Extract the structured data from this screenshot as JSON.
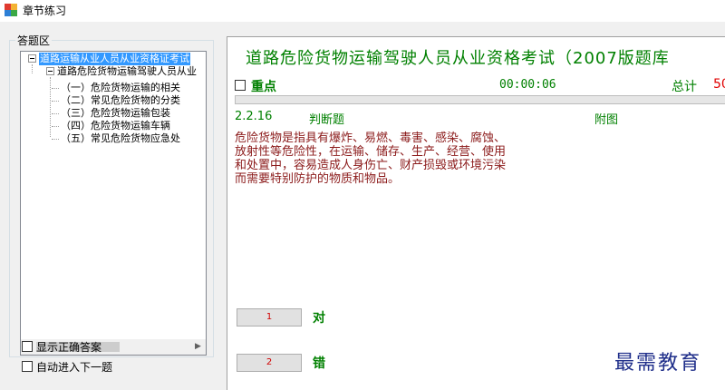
{
  "window": {
    "title": "章节练习"
  },
  "answer_area": {
    "group_title": "答题区",
    "tree": {
      "root": "道路运输从业人员从业资格证考试",
      "child": "道路危险货物运输驾驶人员从业",
      "leaves": [
        "（一）危险货物运输的相关",
        "（二）常见危险货物的分类",
        "（三）危险货物运输包装",
        "（四）危险货物运输车辆",
        "（五）常见危险货物应急处"
      ]
    },
    "options": {
      "show_answer": "显示正确答案",
      "auto_next": "自动进入下一题"
    }
  },
  "exam": {
    "title": "道路危险货物运输驾驶人员从业资格考试（2007版题库",
    "keypoint_label": "重点",
    "timer": "00:00:06",
    "total_label": "总计",
    "total_value": "50",
    "progress_fraction": 0.0
  },
  "question": {
    "number": "2.2.16",
    "type": "判断题",
    "figure_label": "附图",
    "text_lines": [
      "危险货物是指具有爆炸、易燃、毒害、感染、腐蚀、",
      "放射性等危险性，在运输、储存、生产、经营、使用",
      "和处置中，容易造成人身伤亡、财产损毁或环境污染",
      "而需要特别防护的物质和物品。"
    ]
  },
  "answers": [
    {
      "key": "1",
      "label": "对"
    },
    {
      "key": "2",
      "label": "错"
    }
  ],
  "watermark": "最需教育",
  "colors": {
    "accent_green": "#008000",
    "question_text": "#8b1a1a",
    "total_red": "#e00000",
    "tree_selection": "#3399ff",
    "watermark": "#1f2e8a"
  }
}
